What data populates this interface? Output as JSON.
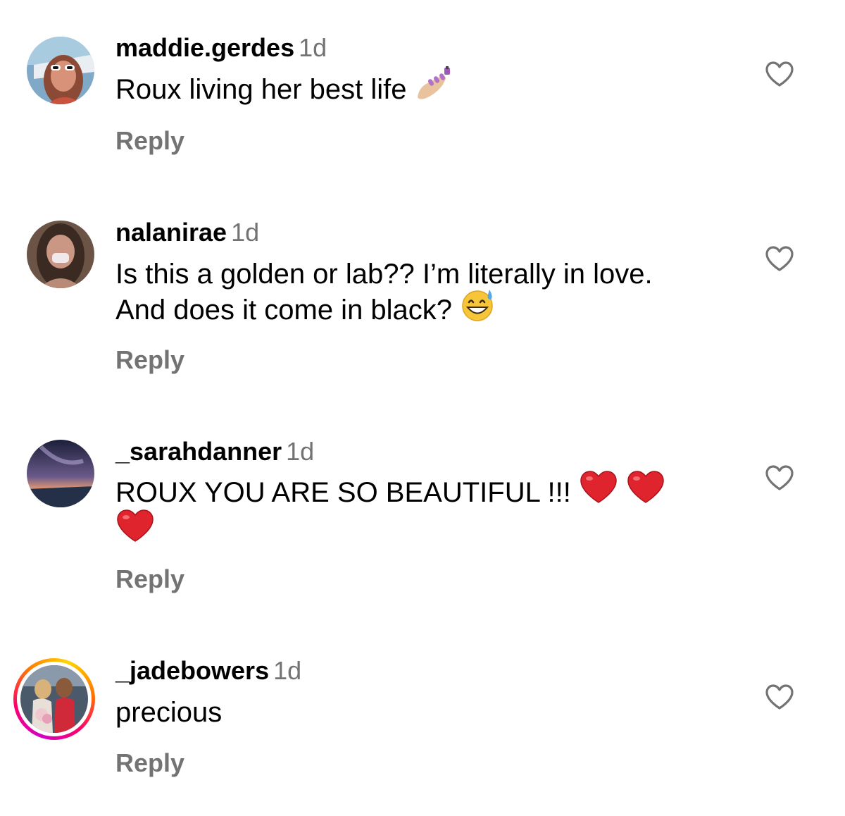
{
  "comments": [
    {
      "username": "maddie.gerdes",
      "time": "1d",
      "text": "Roux living her best life",
      "emoji": "nail-polish-icon",
      "reply_label": "Reply"
    },
    {
      "username": "nalanirae",
      "time": "1d",
      "text": "Is this a golden or lab?? I’m literally in love. And does it come  in black?",
      "emoji": "grinning-sweat-icon",
      "reply_label": "Reply"
    },
    {
      "username": "_sarahdanner",
      "time": "1d",
      "text": "ROUX YOU ARE SO BEAUTIFUL !!!",
      "emoji": "red-heart-icon",
      "reply_label": "Reply"
    },
    {
      "username": "_jadebowers",
      "time": "1d",
      "text": "precious",
      "reply_label": "Reply",
      "has_story_ring": true
    }
  ],
  "colors": {
    "muted": "#737373",
    "text": "#000000",
    "heart": "#e0242e"
  }
}
